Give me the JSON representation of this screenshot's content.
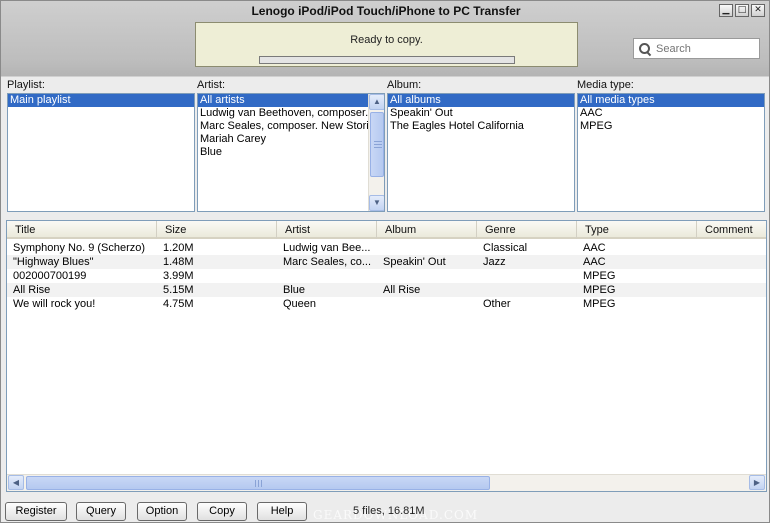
{
  "window": {
    "title": "Lenogo iPod/iPod Touch/iPhone to PC Transfer",
    "controls": {
      "minimize": "▁",
      "maximize": "□",
      "close": "✕"
    }
  },
  "status": {
    "text": "Ready to copy.",
    "progress": 0
  },
  "search": {
    "placeholder": "Search",
    "value": ""
  },
  "filters": {
    "playlist": {
      "label": "Playlist:",
      "items": [
        "Main playlist"
      ],
      "selected": 0
    },
    "artist": {
      "label": "Artist:",
      "items": [
        "All artists",
        "Ludwig van Beethoven, composer.",
        "Marc Seales, composer. New Stories",
        "Mariah Carey",
        "Blue"
      ],
      "selected": 0
    },
    "album": {
      "label": "Album:",
      "items": [
        "All albums",
        "Speakin' Out",
        "The Eagles Hotel California"
      ],
      "selected": 0
    },
    "media_type": {
      "label": "Media type:",
      "items": [
        "All media types",
        "AAC",
        "MPEG"
      ],
      "selected": 0
    }
  },
  "table": {
    "columns": [
      "Title",
      "Size",
      "Artist",
      "Album",
      "Genre",
      "Type",
      "Comment"
    ],
    "rows": [
      [
        "Symphony No. 9 (Scherzo)",
        "1.20M",
        "Ludwig van Bee...",
        "",
        "Classical",
        "AAC",
        ""
      ],
      [
        "\"Highway Blues\"",
        "1.48M",
        "Marc Seales, co...",
        "Speakin' Out",
        "Jazz",
        "AAC",
        ""
      ],
      [
        "002000700199",
        "3.99M",
        "",
        "",
        "",
        "MPEG",
        ""
      ],
      [
        "All Rise",
        "5.15M",
        "Blue",
        "All Rise",
        "",
        "MPEG",
        ""
      ],
      [
        "We will rock you!",
        "4.75M",
        "Queen",
        "",
        "Other",
        "MPEG",
        ""
      ]
    ]
  },
  "buttons": {
    "register": "Register",
    "query": "Query",
    "option": "Option",
    "copy": "Copy",
    "help": "Help"
  },
  "footer": {
    "files_info": "5 files, 16.81M",
    "watermark": "GEARDOWNLOAD.COM"
  },
  "scroll": {
    "left": "◀",
    "right": "▶",
    "up": "▲",
    "down": "▼"
  }
}
